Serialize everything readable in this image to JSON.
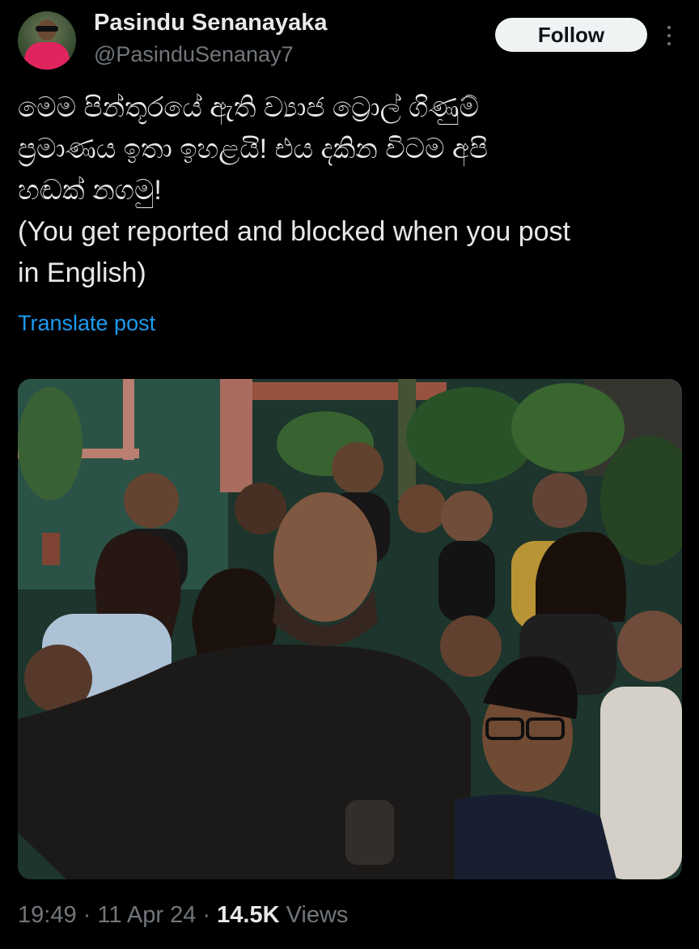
{
  "author": {
    "display_name": "Pasindu Senanayaka",
    "handle": "@PasinduSenanay7",
    "avatar_icon": "profile-photo"
  },
  "header": {
    "follow_label": "Follow",
    "more_icon": "vertical-ellipsis-icon"
  },
  "tweet": {
    "text_lines": [
      "මෙම පින්තූරයේ ඇති ව්‍යාජ ට්‍රොල් ගිණුම්",
      "ප්‍රමාණය ඉතා ඉහළයි! එය දකින විටම අපි",
      "හඬක් නගමු!",
      "(You get reported and blocked when you post",
      "in English)"
    ],
    "translate_label": "Translate post"
  },
  "media": {
    "type": "photo",
    "subject": "group selfie"
  },
  "footer": {
    "time": "19:49",
    "separator1": " · ",
    "date": "11 Apr 24",
    "separator2": " · ",
    "views_count": "14.5K",
    "views_label": " Views"
  },
  "colors": {
    "background": "#000000",
    "text_primary": "#e7e9ea",
    "text_secondary": "#71767b",
    "link": "#1d9bf0",
    "follow_bg": "#eff3f4"
  }
}
